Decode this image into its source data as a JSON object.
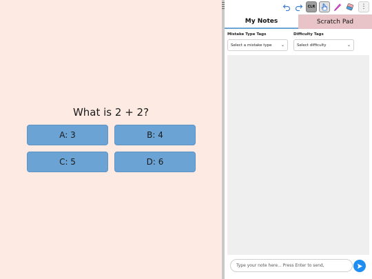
{
  "quiz": {
    "question": "What is 2 + 2?",
    "answers": [
      "A: 3",
      "B: 4",
      "C: 5",
      "D: 6"
    ]
  },
  "toolbar": {
    "undo_icon": "undo-icon",
    "redo_icon": "redo-icon",
    "clear_label": "CLR",
    "hand_icon": "hand-pointer-icon",
    "pen_icon": "pen-icon",
    "eraser_icon": "eraser-icon",
    "more_icon": "more-vertical-icon"
  },
  "tabs": [
    {
      "label": "My Notes",
      "active": true
    },
    {
      "label": "Scratch Pad",
      "active": false
    }
  ],
  "filters": {
    "mistake_label": "Mistake Type Tags",
    "mistake_value": "Select a mistake type",
    "difficulty_label": "Difficulty Tags",
    "difficulty_value": "Select difficulty"
  },
  "composer": {
    "placeholder": "Type your note here... Press Enter to send,"
  },
  "colors": {
    "background": "#fdebe3",
    "answer_button": "#6aa3d4",
    "inactive_tab": "#e8c4c8",
    "send_button": "#1f8ef1"
  }
}
